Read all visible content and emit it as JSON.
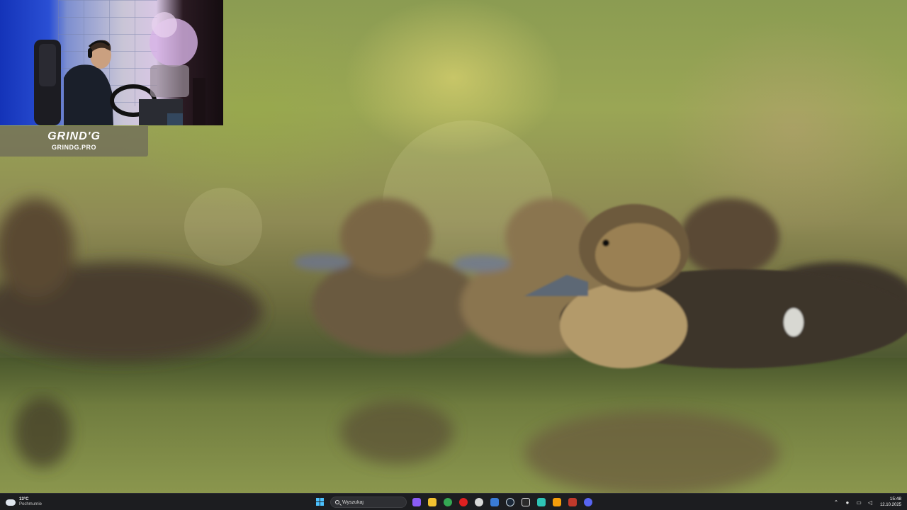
{
  "overlay": {
    "brand_logo": "GRIND'G",
    "brand_url": "GRINDG.PRO"
  },
  "taskbar": {
    "weather": {
      "temperature": "13°C",
      "condition": "Pochmurnie",
      "icon": "cloud-icon"
    },
    "start_icon": "windows-logo-icon",
    "search": {
      "placeholder": "Wyszukaj",
      "value": ""
    },
    "pinned_apps": [
      {
        "name": "copilot-icon",
        "color": "#8a5cf6"
      },
      {
        "name": "file-explorer-icon",
        "color": "#f2c230"
      },
      {
        "name": "chrome-icon",
        "color": "#34a853"
      },
      {
        "name": "opera-icon",
        "color": "#e02020"
      },
      {
        "name": "app-icon-5",
        "color": "#d8d8d8"
      },
      {
        "name": "app-icon-6",
        "color": "#3a7bd5"
      },
      {
        "name": "steam-icon",
        "color": "#1b2838"
      },
      {
        "name": "epic-games-icon",
        "color": "#2b2b2b"
      },
      {
        "name": "app-icon-9",
        "color": "#2ec4b6"
      },
      {
        "name": "app-icon-10",
        "color": "#f59e0b"
      },
      {
        "name": "app-icon-11",
        "color": "#c0392b"
      },
      {
        "name": "discord-icon",
        "color": "#5865f2"
      }
    ],
    "tray": {
      "icons": [
        "chevron-up-icon",
        "microphone-icon",
        "network-icon",
        "volume-icon"
      ],
      "time": "15:48",
      "date": "12.10.2025"
    }
  }
}
